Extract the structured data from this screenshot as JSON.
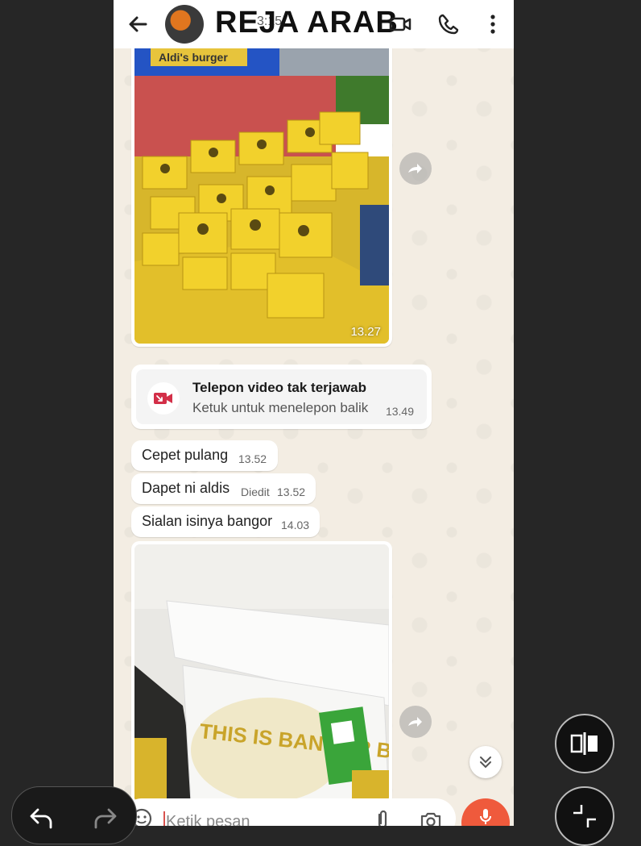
{
  "header": {
    "contact_name": "REJA ARAB",
    "status_time": "3:15"
  },
  "messages": {
    "image1_time": "13.27",
    "call_title": "Telepon video tak terjawab",
    "call_subtitle": "Ketuk untuk menelepon balik",
    "call_time": "13.49",
    "msg1_text": "Cepet pulang",
    "msg1_time": "13.52",
    "msg2_text": "Dapet ni aldis",
    "msg2_edited": "Diedit",
    "msg2_time": "13.52",
    "msg3_text": "Sialan isinya bangor",
    "msg3_time": "14.03",
    "image1_sign": "Aldi's burger",
    "image2_print": "THIS IS BANGOR BURGERNYA"
  },
  "composer": {
    "placeholder": "Ketik pesan"
  },
  "icons": [
    "back-arrow-icon",
    "video-call-icon",
    "phone-icon",
    "more-vert-icon",
    "forward-icon",
    "missed-video-call-icon",
    "chevron-double-down-icon",
    "emoji-icon",
    "attach-icon",
    "camera-icon",
    "mic-icon",
    "split-screen-icon",
    "minimize-icon",
    "undo-icon",
    "redo-icon"
  ],
  "colors": {
    "accent_red": "#ef5a3c",
    "missed_call_red": "#d32f48",
    "chat_bg": "#f3ede3"
  }
}
